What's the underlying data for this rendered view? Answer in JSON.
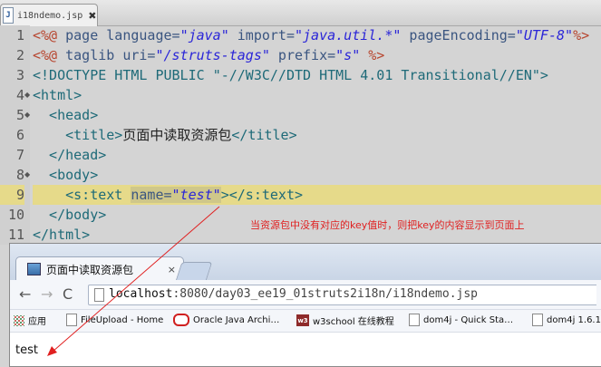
{
  "editor": {
    "tab_title": "i18ndemo.jsp",
    "tab_icon": "J",
    "close_glyph": "✖",
    "line_numbers": [
      "1",
      "2",
      "3",
      "4",
      "5",
      "6",
      "7",
      "8",
      "9",
      "10",
      "11"
    ],
    "current_line": "9",
    "lines": {
      "l1": {
        "a": "<%@ ",
        "b": "page ",
        "c": "language=",
        "d": "\"java\"",
        "e": " import=",
        "f": "\"java.util.*\"",
        "g": " pageEncoding=",
        "h": "\"UTF-8\"",
        "i": "%>"
      },
      "l2": {
        "a": "<%@ ",
        "b": "taglib ",
        "c": "uri=",
        "d": "\"/struts-tags\"",
        "e": " prefix=",
        "f": "\"s\"",
        "g": " %>"
      },
      "l3": {
        "a": "<!DOCTYPE HTML PUBLIC ",
        "b": "\"-//W3C//DTD HTML 4.01 Transitional//EN\">"
      },
      "l4": {
        "a": "<html>"
      },
      "l5": {
        "a": "  <head>"
      },
      "l6": {
        "a": "    <title>",
        "b": "页面中读取资源包",
        "c": "</title>"
      },
      "l7": {
        "a": "  </head>"
      },
      "l8": {
        "a": "  <body>"
      },
      "l9": {
        "a": "    <s:text ",
        "b": "name=",
        "c": "\"test\"",
        "d": "></s:text>"
      },
      "l10": {
        "a": "  </body>"
      },
      "l11": {
        "a": "</html>"
      }
    }
  },
  "annotation": "当资源包中没有对应的key值时，则把key的内容显示到页面上",
  "browser": {
    "tab_title": "页面中读取资源包",
    "tab_close": "×",
    "nav": {
      "back": "←",
      "forward": "→",
      "reload": "C"
    },
    "url_host": "localhost",
    "url_rest": ":8080/day03_ee19_01struts2i18n/i18ndemo.jsp",
    "bookmarks": [
      "应用",
      "FileUpload - Home",
      "Oracle Java Archi…",
      "w3school 在线教程",
      "dom4j - Quick Sta…",
      "dom4j 1.6.1"
    ],
    "w3_badge": "w3",
    "page_text": "test"
  },
  "colors": {
    "annotation": "#e02020",
    "current_line": "#e6da8a",
    "arrow": "#e02020"
  }
}
